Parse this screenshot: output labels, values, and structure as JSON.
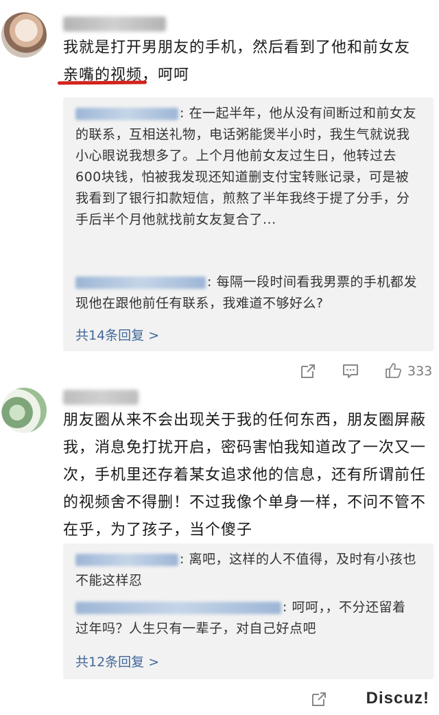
{
  "comments": [
    {
      "text_line1": "我就是打开男朋友的手机，然后看到了他和前女友",
      "text_line2_a": "亲嘴的视频",
      "text_line2_b": "，呵呵",
      "replies": [
        {
          "text": ": 在一起半年，他从没有间断过和前女友的联系，互相送礼物，电话粥能煲半小时，我生气就说我小心眼说我想多了。上个月他前女友过生日，他转过去600块钱，怕被我发现还知道删支付宝转账记录，可是被我看到了银行扣款短信，煎熬了半年我终于提了分手，分手后半个月他就找前女友复合了..."
        },
        {
          "text": ": 每隔一段时间看我男票的手机都发现他在跟他前任有联系，我难道不够好么?"
        }
      ],
      "more_replies": "共14条回复 >",
      "like_count": "333"
    },
    {
      "text": "朋友圈从来不会出现关于我的任何东西，朋友圈屏蔽我，消息免打扰开启，密码害怕我知道改了一次又一次，手机里还存着某女追求他的信息，还有所谓前任的视频舍不得删！不过我像个单身一样，不问不管不在乎，为了孩子，当个傻子",
      "replies": [
        {
          "text": ": 离吧，这样的人不值得，及时有小孩也不能这样忍"
        },
        {
          "text": ": 呵呵，，不分还留着过年吗？人生只有一辈子，对自己好点吧"
        }
      ],
      "more_replies": "共12条回复 >"
    }
  ],
  "watermark": "Discuz!",
  "colors": {
    "link": "#41689a",
    "underline": "#d3221c",
    "reply_bg": "#f2f2f2"
  }
}
